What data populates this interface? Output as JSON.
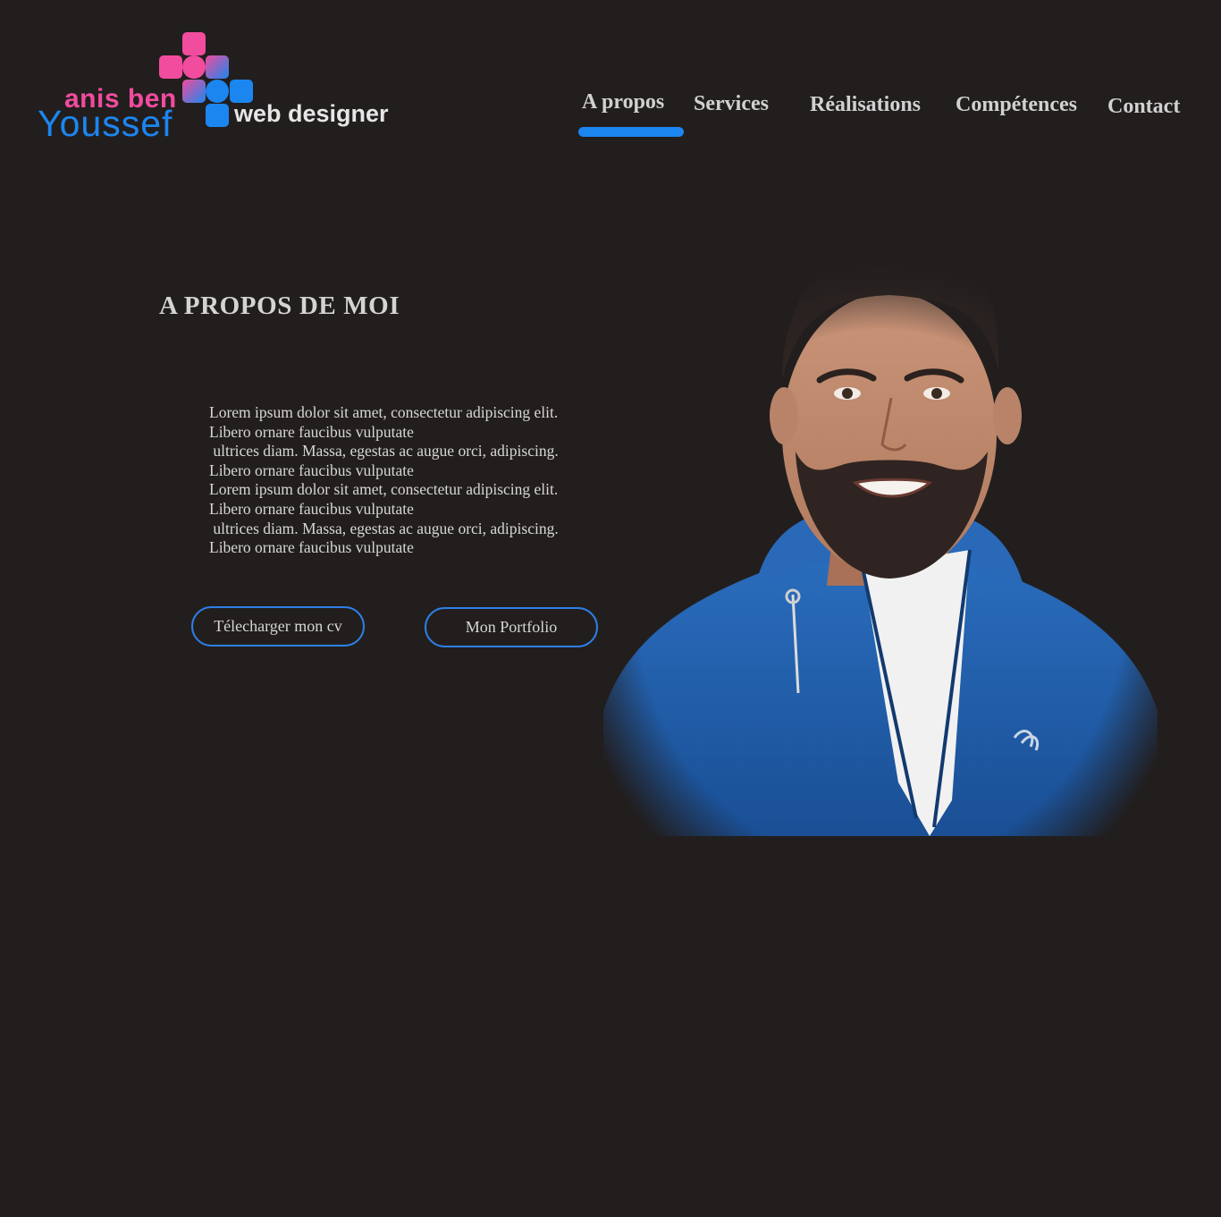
{
  "logo": {
    "line1": "anis ben",
    "line2": "Youssef",
    "tagline": "web designer"
  },
  "nav": {
    "items": [
      "A propos",
      "Services",
      "Réalisations",
      "Compétences",
      "Contact"
    ],
    "active": "A propos"
  },
  "about": {
    "title": "A PROPOS DE MOI",
    "paragraph_lines": [
      "Lorem ipsum dolor sit amet, consectetur adipiscing elit.",
      "Libero ornare faucibus vulputate",
      " ultrices diam. Massa, egestas ac augue orci, adipiscing.",
      "Libero ornare faucibus vulputate",
      "Lorem ipsum dolor sit amet, consectetur adipiscing elit.",
      "Libero ornare faucibus vulputate",
      " ultrices diam. Massa, egestas ac augue orci, adipiscing.",
      "Libero ornare faucibus vulputate"
    ],
    "buttons": {
      "cv": "Télecharger mon cv",
      "portfolio": "Mon Portfolio"
    }
  },
  "colors": {
    "background": "#221e1e",
    "accent": "#1c86f0",
    "brand_pink": "#f14c9e"
  }
}
